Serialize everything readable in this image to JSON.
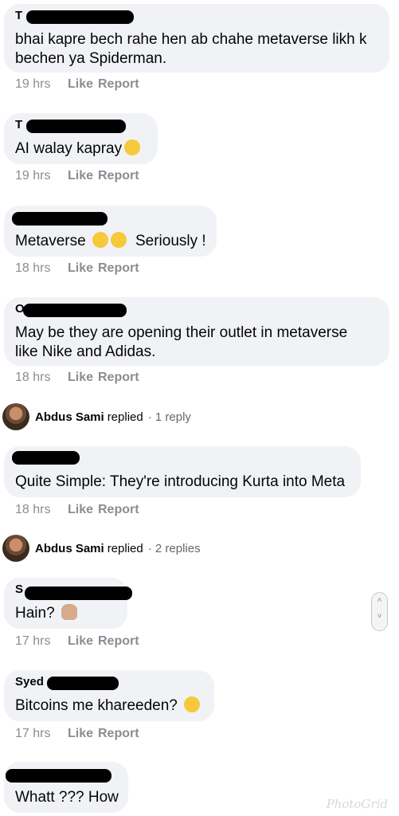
{
  "comments": [
    {
      "author": "T",
      "text_lines": [
        "bhai kapre bech rahe hen ab chahe metaverse likh k",
        "bechen ya Spiderman."
      ],
      "time": "19 hrs",
      "like": "Like",
      "report": "Report"
    },
    {
      "author": "T",
      "text_lines": [
        "AI walay kapray"
      ],
      "emoji": "rolling-on-floor-laughing-emoji",
      "time": "19 hrs",
      "like": "Like",
      "report": "Report"
    },
    {
      "author": "",
      "text_lines": [
        "Metaverse",
        "Seriously !"
      ],
      "emoji": "monocle-face-emoji",
      "emoji2": "face-with-raised-eyebrow-emoji",
      "time": "18 hrs",
      "like": "Like",
      "report": "Report"
    },
    {
      "author": "O",
      "text_lines": [
        "May be they are opening their outlet in metaverse",
        "like Nike and Adidas."
      ],
      "time": "18 hrs",
      "like": "Like",
      "report": "Report"
    },
    {
      "author": "",
      "text_lines": [
        "Quite Simple: They're introducing Kurta into Meta"
      ],
      "time": "18 hrs",
      "like": "Like",
      "report": "Report"
    },
    {
      "author": "S",
      "text_lines": [
        "Hain?"
      ],
      "emoji": "woman-facepalming-emoji",
      "time": "17 hrs",
      "like": "Like",
      "report": "Report"
    },
    {
      "author": "Syed",
      "text_lines": [
        "Bitcoins me khareeden?"
      ],
      "emoji": "tears-of-joy-emoji",
      "time": "17 hrs",
      "like": "Like",
      "report": "Report"
    },
    {
      "author": "",
      "text_lines": [
        "Whatt ??? How"
      ]
    }
  ],
  "replies": [
    {
      "name": "Abdus Sami",
      "verb": "replied",
      "count": "· 1 reply"
    },
    {
      "name": "Abdus Sami",
      "verb": "replied",
      "count": "· 2 replies"
    }
  ],
  "watermark": "PhotoGrid",
  "scroll_icon": "scroll-handle-icon"
}
